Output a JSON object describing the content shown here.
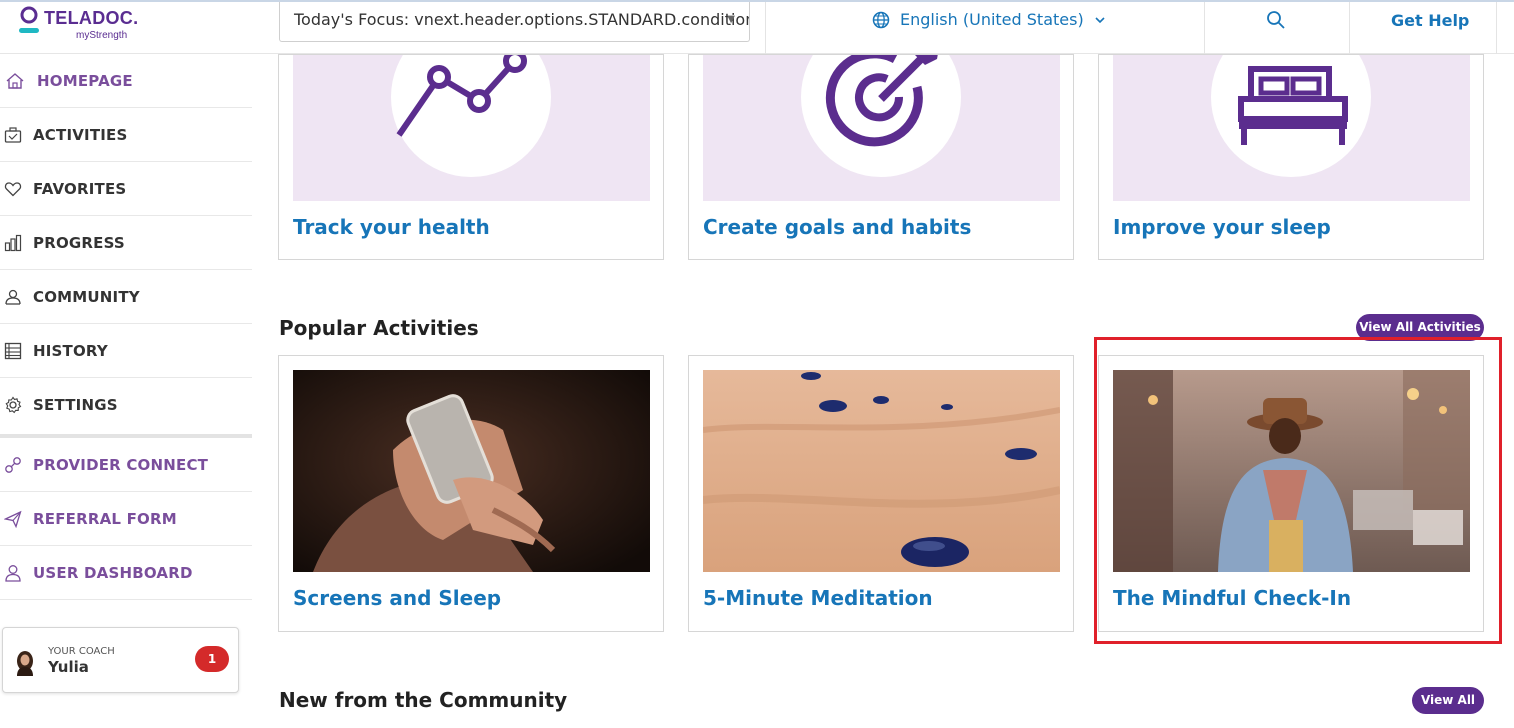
{
  "header": {
    "brand": "TELADOC.",
    "brand_sub": "myStrength",
    "focus_label": "Today's Focus: vnext.header.options.STANDARD.condition:",
    "language": "English (United States)",
    "get_help": "Get Help"
  },
  "sidebar": {
    "items": [
      {
        "label": "HOMEPAGE",
        "icon": "home-icon"
      },
      {
        "label": "ACTIVITIES",
        "icon": "activities-icon"
      },
      {
        "label": "FAVORITES",
        "icon": "heart-icon"
      },
      {
        "label": "PROGRESS",
        "icon": "bar-chart-icon"
      },
      {
        "label": "COMMUNITY",
        "icon": "community-icon"
      },
      {
        "label": "HISTORY",
        "icon": "history-icon"
      },
      {
        "label": "SETTINGS",
        "icon": "gear-icon"
      },
      {
        "label": "PROVIDER CONNECT",
        "icon": "link-icon"
      },
      {
        "label": "REFERRAL FORM",
        "icon": "send-icon"
      },
      {
        "label": "USER DASHBOARD",
        "icon": "user-icon"
      }
    ],
    "coach": {
      "caption": "YOUR COACH",
      "name": "Yulia",
      "badge": "1"
    }
  },
  "top_cards": [
    {
      "title": "Track your health",
      "icon": "line-chart-icon"
    },
    {
      "title": "Create goals and habits",
      "icon": "target-icon"
    },
    {
      "title": "Improve your sleep",
      "icon": "bed-icon"
    }
  ],
  "popular": {
    "title": "Popular Activities",
    "view_all": "View All Activities",
    "cards": [
      {
        "title": "Screens and Sleep",
        "image": "hands-holding-phone"
      },
      {
        "title": "5-Minute Meditation",
        "image": "stones-in-sand"
      },
      {
        "title": "The Mindful Check-In",
        "image": "man-on-city-street"
      }
    ]
  },
  "community": {
    "title": "New from the Community",
    "view_all": "View All"
  },
  "colors": {
    "brand_purple": "#5b2d8e",
    "link_blue": "#1775b8",
    "card_bg_lilac": "#efe5f3",
    "highlight_red": "#e0202a",
    "badge_red": "#d42a2a"
  }
}
